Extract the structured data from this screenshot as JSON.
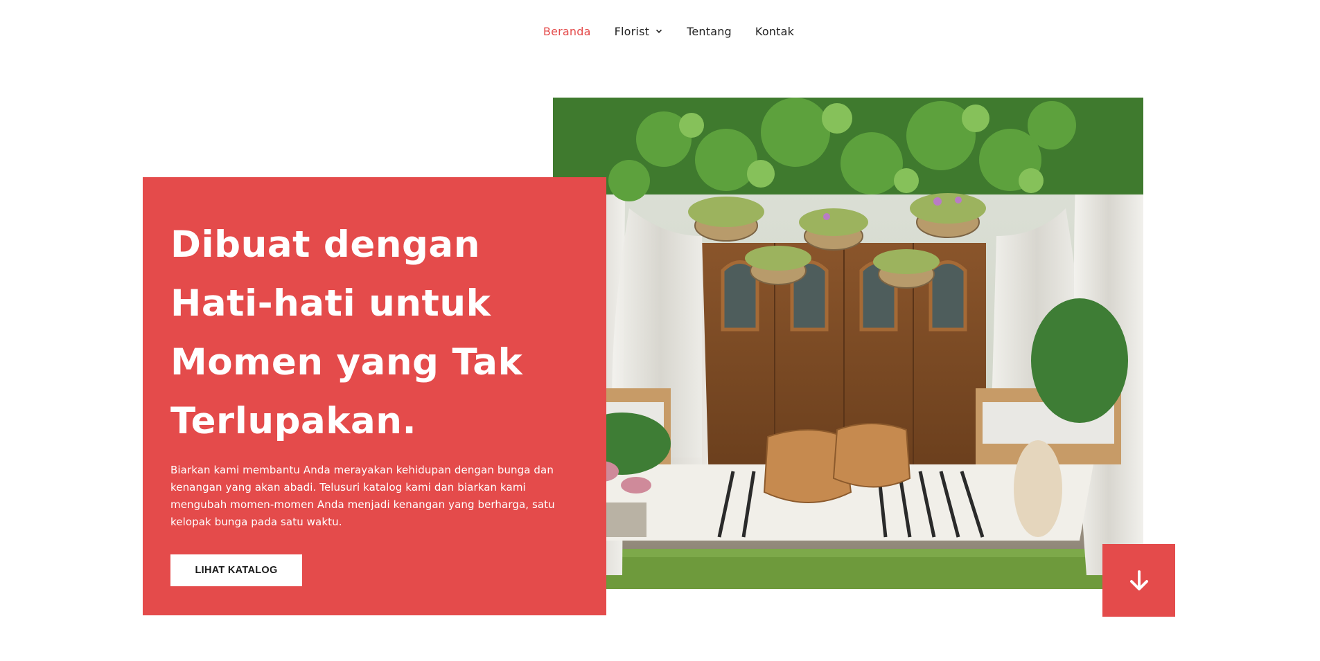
{
  "nav": {
    "items": [
      {
        "label": "Beranda",
        "active": true
      },
      {
        "label": "Florist",
        "has_dropdown": true
      },
      {
        "label": "Tentang"
      },
      {
        "label": "Kontak"
      }
    ]
  },
  "hero": {
    "headline": "Dibuat dengan Hati-hati untuk Momen yang Tak Terlupakan.",
    "description": "Biarkan kami membantu Anda merayakan kehidupan dengan bunga dan kenangan yang akan abadi. Telusuri katalog kami dan biarkan kami mengubah momen-momen Anda menjadi kenangan yang berharga, satu kelopak bunga pada satu waktu.",
    "cta_label": "LIHAT KATALOG"
  },
  "icons": {
    "scroll_down": "arrow-down-icon",
    "dropdown": "chevron-down-icon"
  },
  "colors": {
    "accent": "#e44b4b",
    "text": "#1d1d1d",
    "background": "#ffffff"
  }
}
